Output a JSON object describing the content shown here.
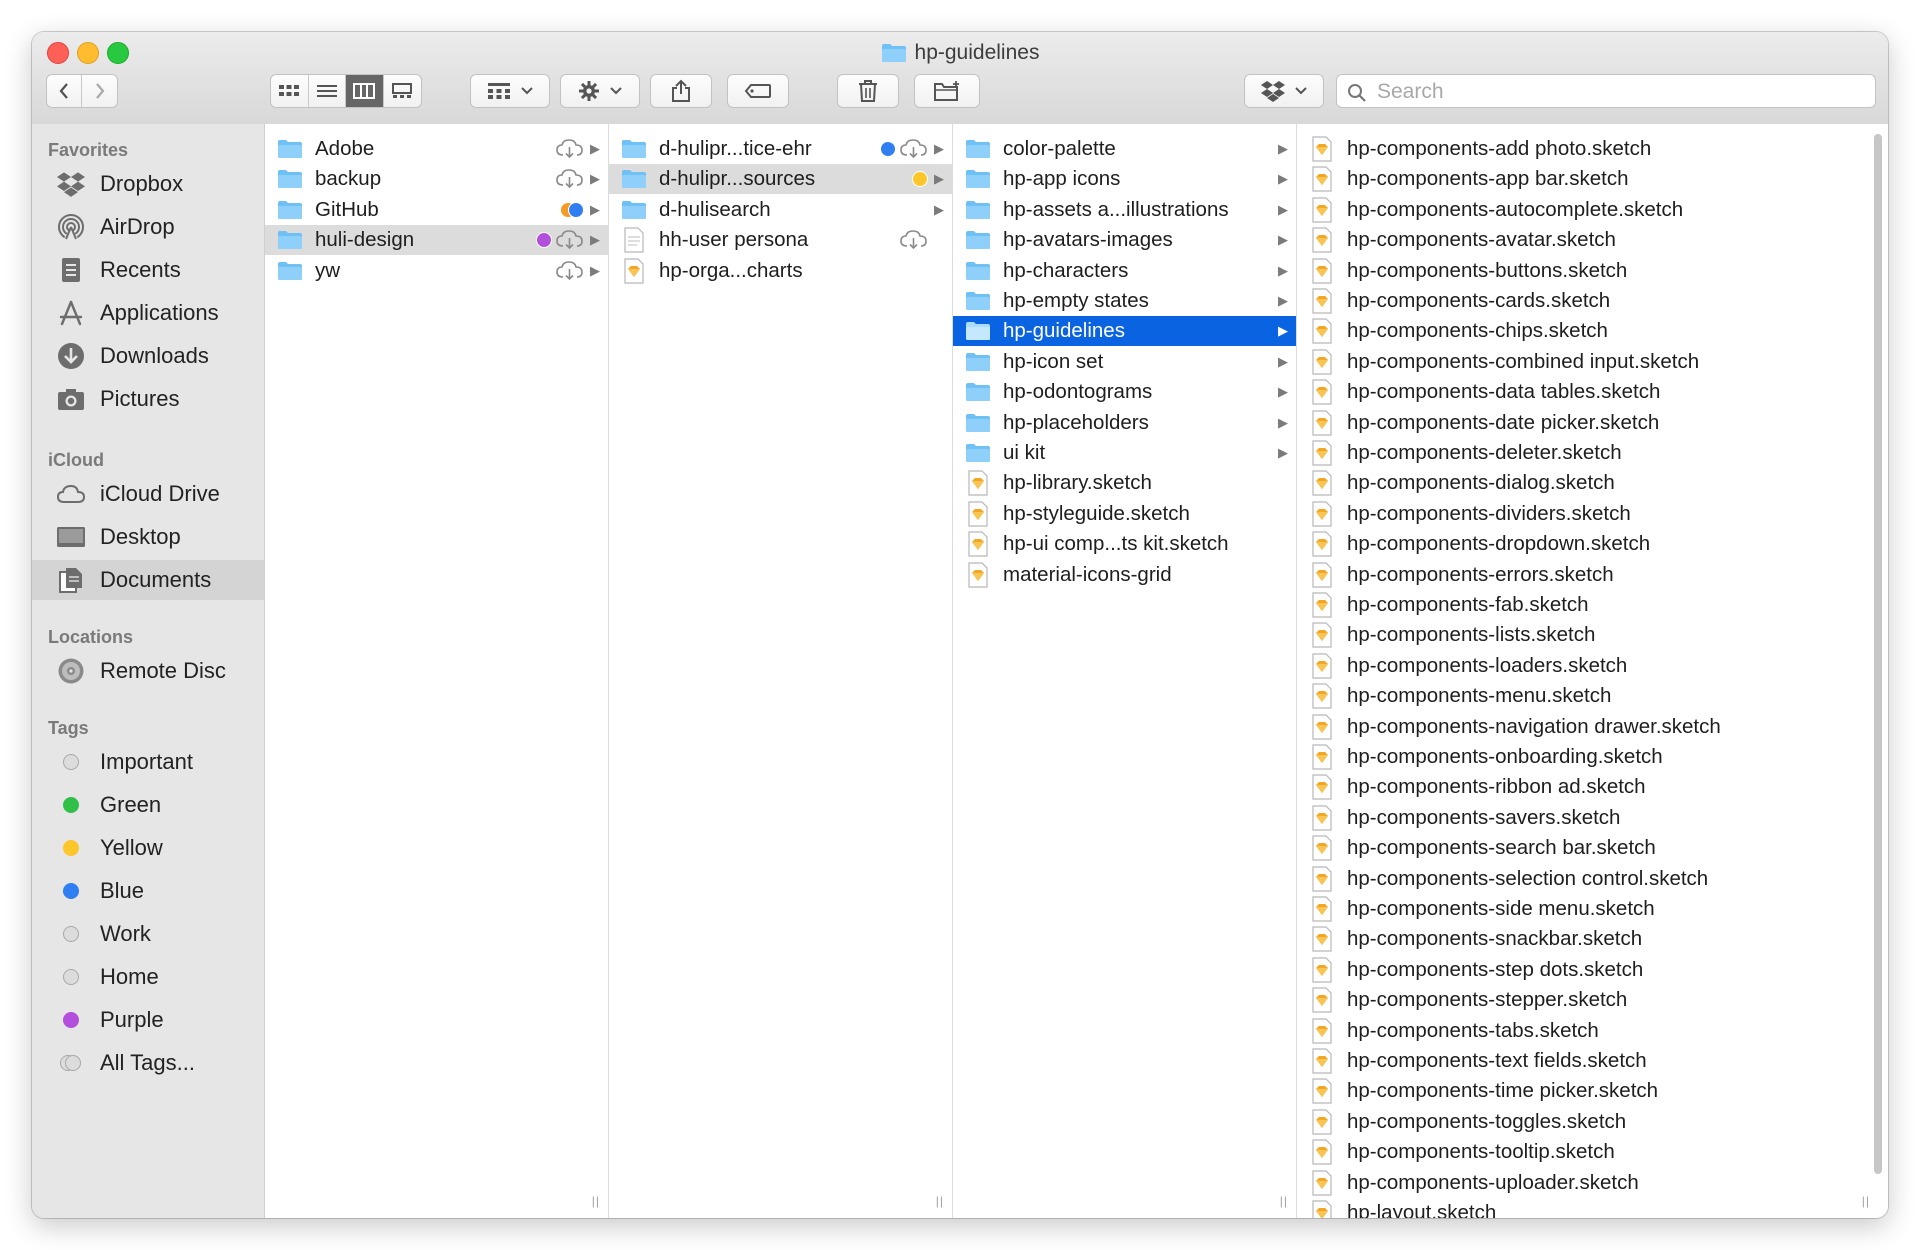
{
  "window": {
    "title": "hp-guidelines"
  },
  "toolbar": {
    "back_icon": "chevron-left-icon",
    "forward_icon": "chevron-right-icon",
    "view_modes": [
      "icon-view-icon",
      "list-view-icon",
      "column-view-icon",
      "gallery-view-icon"
    ],
    "selected_view": "column",
    "group_icon": "group-by-icon",
    "action_icon": "gear-icon",
    "share_icon": "share-icon",
    "tag_icon": "tag-icon",
    "trash_icon": "trash-icon",
    "new_folder_icon": "new-folder-icon",
    "dropbox_icon": "dropbox-icon",
    "search_placeholder": "Search"
  },
  "sidebar": {
    "favorites_header": "Favorites",
    "favorites": [
      {
        "label": "Dropbox",
        "icon": "dropbox-icon"
      },
      {
        "label": "AirDrop",
        "icon": "airdrop-icon"
      },
      {
        "label": "Recents",
        "icon": "recents-icon"
      },
      {
        "label": "Applications",
        "icon": "applications-icon"
      },
      {
        "label": "Downloads",
        "icon": "downloads-icon"
      },
      {
        "label": "Pictures",
        "icon": "pictures-icon"
      }
    ],
    "icloud_header": "iCloud",
    "icloud": [
      {
        "label": "iCloud Drive",
        "icon": "cloud-icon"
      },
      {
        "label": "Desktop",
        "icon": "desktop-icon"
      },
      {
        "label": "Documents",
        "icon": "documents-icon",
        "selected": true
      }
    ],
    "locations_header": "Locations",
    "locations": [
      {
        "label": "Remote Disc",
        "icon": "disc-icon"
      }
    ],
    "tags_header": "Tags",
    "tags": [
      {
        "label": "Important",
        "color": "#d9d9d9"
      },
      {
        "label": "Green",
        "color": "#30c04a"
      },
      {
        "label": "Yellow",
        "color": "#fdc62b"
      },
      {
        "label": "Blue",
        "color": "#2f7ff2"
      },
      {
        "label": "Work",
        "color": "#d9d9d9"
      },
      {
        "label": "Home",
        "color": "#d9d9d9"
      },
      {
        "label": "Purple",
        "color": "#b24fdc"
      },
      {
        "label": "All Tags...",
        "color": "#d9d9d9"
      }
    ]
  },
  "columns": [
    {
      "items": [
        {
          "name": "Adobe",
          "kind": "folder",
          "cloud": true,
          "arrow": true
        },
        {
          "name": "backup",
          "kind": "folder",
          "cloud": true,
          "arrow": true
        },
        {
          "name": "GitHub",
          "kind": "folder",
          "tags": [
            "#f59a23",
            "#2f7ff2"
          ],
          "arrow": true
        },
        {
          "name": "huli-design",
          "kind": "folder",
          "tags": [
            "#b24fdc"
          ],
          "cloud": true,
          "arrow": true,
          "state": "gray"
        },
        {
          "name": "yw",
          "kind": "folder",
          "cloud": true,
          "arrow": true
        }
      ]
    },
    {
      "items": [
        {
          "name": "d-hulipr...tice-ehr",
          "kind": "folder",
          "tags": [
            "#2f7ff2"
          ],
          "cloud": true,
          "arrow": true
        },
        {
          "name": "d-hulipr...sources",
          "kind": "folder",
          "tags": [
            "#fdc62b"
          ],
          "arrow": true,
          "state": "gray"
        },
        {
          "name": "d-hulisearch",
          "kind": "folder",
          "arrow": true
        },
        {
          "name": "hh-user persona",
          "kind": "document",
          "cloud": true
        },
        {
          "name": "hp-orga...charts",
          "kind": "sketch"
        }
      ]
    },
    {
      "items": [
        {
          "name": "color-palette",
          "kind": "folder",
          "arrow": true
        },
        {
          "name": "hp-app icons",
          "kind": "folder",
          "arrow": true
        },
        {
          "name": "hp-assets a...illustrations",
          "kind": "folder",
          "arrow": true
        },
        {
          "name": "hp-avatars-images",
          "kind": "folder",
          "arrow": true
        },
        {
          "name": "hp-characters",
          "kind": "folder",
          "arrow": true
        },
        {
          "name": "hp-empty states",
          "kind": "folder",
          "arrow": true
        },
        {
          "name": "hp-guidelines",
          "kind": "folder",
          "arrow": true,
          "state": "blue"
        },
        {
          "name": "hp-icon set",
          "kind": "folder",
          "arrow": true
        },
        {
          "name": "hp-odontograms",
          "kind": "folder",
          "arrow": true
        },
        {
          "name": "hp-placeholders",
          "kind": "folder",
          "arrow": true
        },
        {
          "name": "ui kit",
          "kind": "folder",
          "arrow": true
        },
        {
          "name": "hp-library.sketch",
          "kind": "sketch"
        },
        {
          "name": "hp-styleguide.sketch",
          "kind": "sketch"
        },
        {
          "name": "hp-ui comp...ts kit.sketch",
          "kind": "sketch"
        },
        {
          "name": "material-icons-grid",
          "kind": "sketch"
        }
      ]
    },
    {
      "items": [
        {
          "name": "hp-components-add photo.sketch",
          "kind": "sketch"
        },
        {
          "name": "hp-components-app bar.sketch",
          "kind": "sketch"
        },
        {
          "name": "hp-components-autocomplete.sketch",
          "kind": "sketch"
        },
        {
          "name": "hp-components-avatar.sketch",
          "kind": "sketch"
        },
        {
          "name": "hp-components-buttons.sketch",
          "kind": "sketch"
        },
        {
          "name": "hp-components-cards.sketch",
          "kind": "sketch"
        },
        {
          "name": "hp-components-chips.sketch",
          "kind": "sketch"
        },
        {
          "name": "hp-components-combined input.sketch",
          "kind": "sketch"
        },
        {
          "name": "hp-components-data tables.sketch",
          "kind": "sketch"
        },
        {
          "name": "hp-components-date picker.sketch",
          "kind": "sketch"
        },
        {
          "name": "hp-components-deleter.sketch",
          "kind": "sketch"
        },
        {
          "name": "hp-components-dialog.sketch",
          "kind": "sketch"
        },
        {
          "name": "hp-components-dividers.sketch",
          "kind": "sketch"
        },
        {
          "name": "hp-components-dropdown.sketch",
          "kind": "sketch"
        },
        {
          "name": "hp-components-errors.sketch",
          "kind": "sketch"
        },
        {
          "name": "hp-components-fab.sketch",
          "kind": "sketch"
        },
        {
          "name": "hp-components-lists.sketch",
          "kind": "sketch"
        },
        {
          "name": "hp-components-loaders.sketch",
          "kind": "sketch"
        },
        {
          "name": "hp-components-menu.sketch",
          "kind": "sketch"
        },
        {
          "name": "hp-components-navigation drawer.sketch",
          "kind": "sketch"
        },
        {
          "name": "hp-components-onboarding.sketch",
          "kind": "sketch"
        },
        {
          "name": "hp-components-ribbon ad.sketch",
          "kind": "sketch"
        },
        {
          "name": "hp-components-savers.sketch",
          "kind": "sketch"
        },
        {
          "name": "hp-components-search bar.sketch",
          "kind": "sketch"
        },
        {
          "name": "hp-components-selection control.sketch",
          "kind": "sketch"
        },
        {
          "name": "hp-components-side menu.sketch",
          "kind": "sketch"
        },
        {
          "name": "hp-components-snackbar.sketch",
          "kind": "sketch"
        },
        {
          "name": "hp-components-step dots.sketch",
          "kind": "sketch"
        },
        {
          "name": "hp-components-stepper.sketch",
          "kind": "sketch"
        },
        {
          "name": "hp-components-tabs.sketch",
          "kind": "sketch"
        },
        {
          "name": "hp-components-text fields.sketch",
          "kind": "sketch"
        },
        {
          "name": "hp-components-time picker.sketch",
          "kind": "sketch"
        },
        {
          "name": "hp-components-toggles.sketch",
          "kind": "sketch"
        },
        {
          "name": "hp-components-tooltip.sketch",
          "kind": "sketch"
        },
        {
          "name": "hp-components-uploader.sketch",
          "kind": "sketch"
        },
        {
          "name": "hp-layout.sketch",
          "kind": "sketch"
        }
      ]
    }
  ],
  "colors": {
    "selection_blue": "#0a63e0",
    "folder_blue": "#6ec0f5",
    "sketch_orange": "#f3a623"
  }
}
